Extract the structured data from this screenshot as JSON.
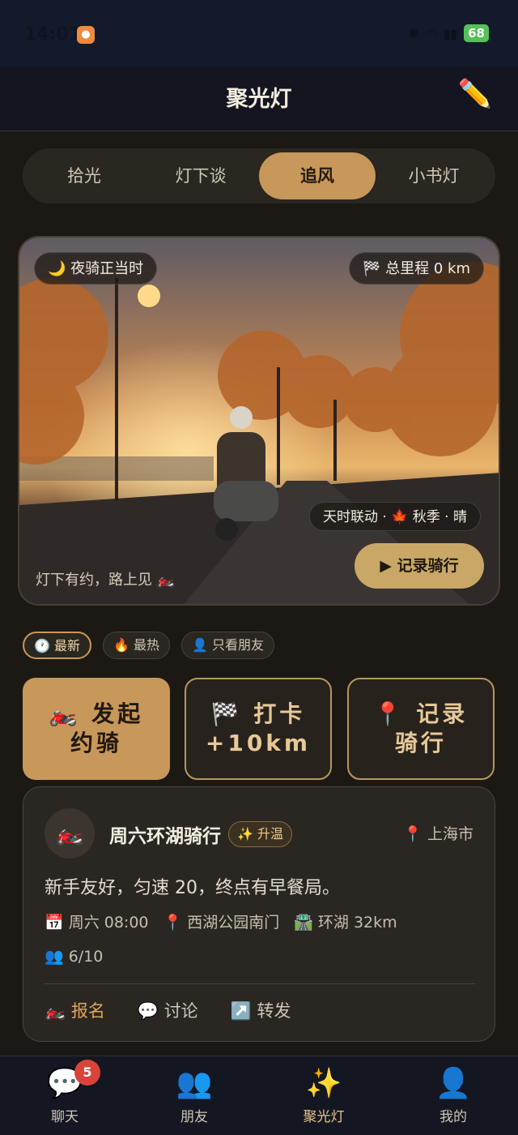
{
  "status_bar": {
    "time": "14:01",
    "battery": "68"
  },
  "header": {
    "title": "聚光灯"
  },
  "tabs": [
    {
      "label": "拾光",
      "active": false
    },
    {
      "label": "灯下谈",
      "active": false
    },
    {
      "label": "追风",
      "active": true
    },
    {
      "label": "小书灯",
      "active": false
    }
  ],
  "hero": {
    "night_ride": "🌙 夜骑正当时",
    "total_distance": "🏁 总里程 0 km",
    "weather": "天时联动 · 🍁 秋季 · 晴",
    "caption": "灯下有约，路上见 🏍️",
    "record_button": "▶ 记录骑行"
  },
  "filters": [
    {
      "label": "🕐 最新",
      "active": true
    },
    {
      "label": "🔥 最热",
      "active": false
    },
    {
      "label": "👤 只看朋友",
      "active": false
    }
  ],
  "actions": [
    {
      "icon": "🏍️",
      "line1": "发起",
      "line2": "约骑"
    },
    {
      "icon": "🏁",
      "line1": "打卡",
      "line2": "+10km"
    },
    {
      "icon": "📍",
      "line1": "记录",
      "line2": "骑行"
    }
  ],
  "post": {
    "avatar": "🏍️",
    "title": "周六环湖骑行",
    "badge": "✨ 升温",
    "location": "📍 上海市",
    "body": "新手友好，匀速 20，终点有早餐局。",
    "time": "📅 周六 08:00",
    "place": "📍 西湖公园南门",
    "route": "🛣️ 环湖 32km",
    "participants": "👥 6/10",
    "signup": "🏍️ 报名",
    "discuss": "💬 讨论",
    "share": "↗️ 转发"
  },
  "bottom_nav": [
    {
      "icon": "💬",
      "label": "聊天",
      "badge": "5"
    },
    {
      "icon": "👥",
      "label": "朋友"
    },
    {
      "icon": "✨",
      "label": "聚光灯",
      "active": true
    },
    {
      "icon": "👤",
      "label": "我的"
    }
  ],
  "colors": {
    "accent": "#c8975a",
    "background": "#1c1915",
    "badge": "#d9433a"
  }
}
